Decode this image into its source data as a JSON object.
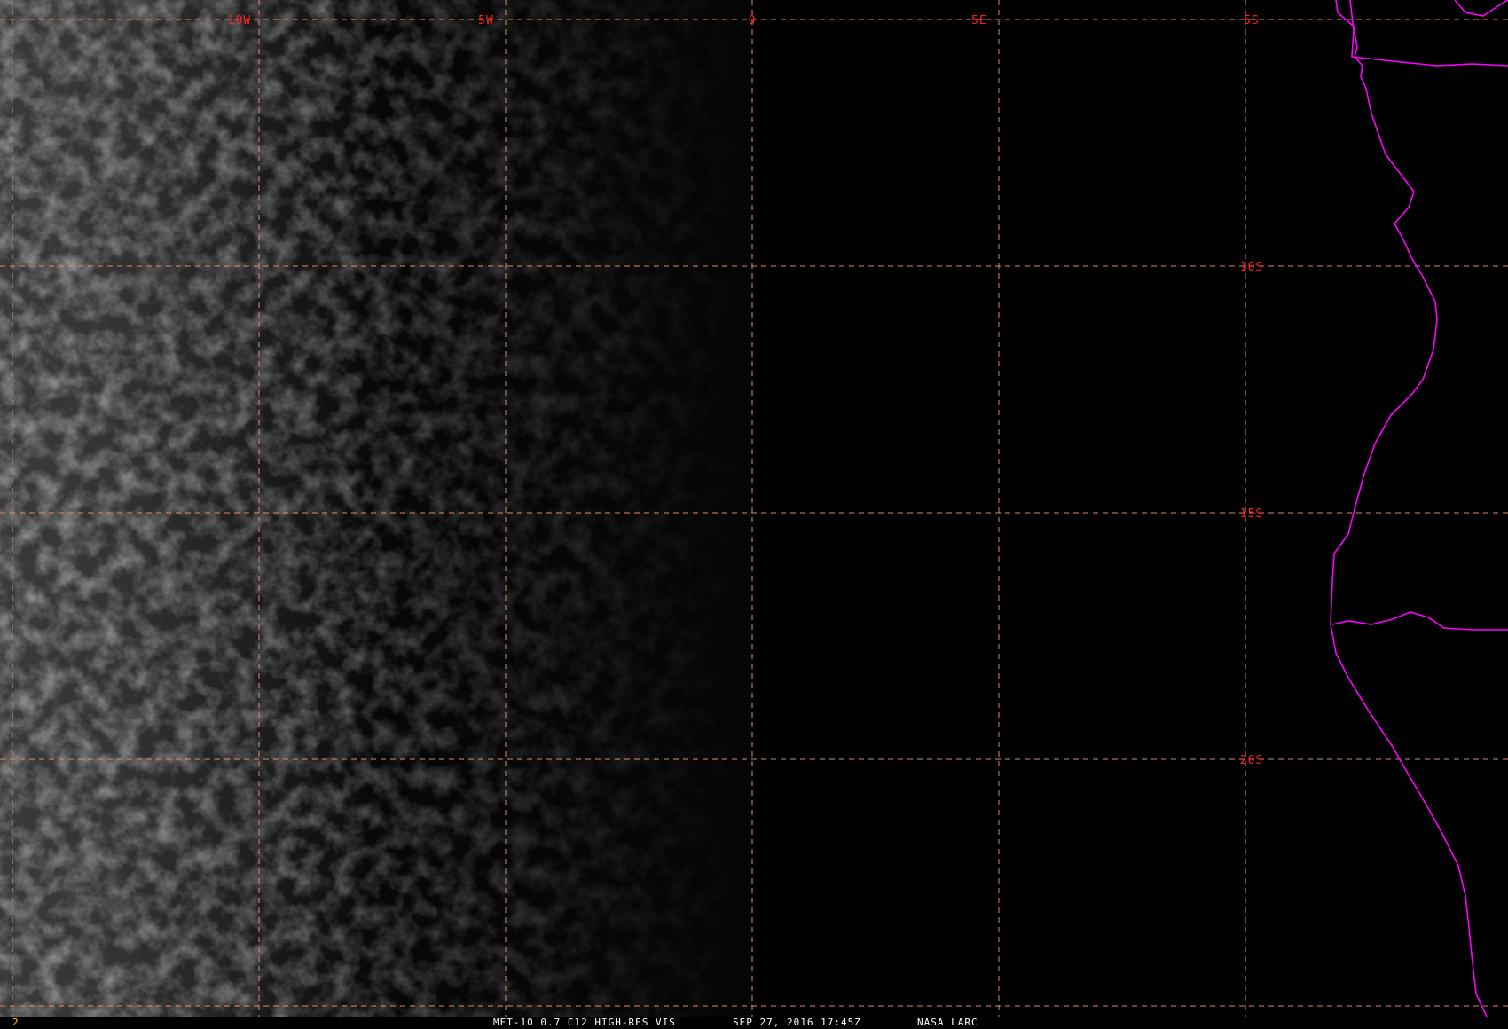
{
  "map": {
    "grid_color": "#e0896a",
    "label_color": "#ff2020",
    "coastline_color": "#ff00ff",
    "longitude_labels": [
      "10W",
      "5W",
      "0",
      "5E"
    ],
    "latitude_labels": [
      "5S",
      "10S",
      "15S",
      "20S"
    ],
    "longitude_values_deg": [
      -10,
      -5,
      0,
      5
    ],
    "latitude_values_deg": [
      -5,
      -10,
      -15,
      -20
    ]
  },
  "status": {
    "frame_number": "2",
    "product": "MET-10 0.7 C12 HIGH-RES VIS",
    "datetime": "SEP 27, 2016 17:45Z",
    "source": "NASA LARC"
  }
}
